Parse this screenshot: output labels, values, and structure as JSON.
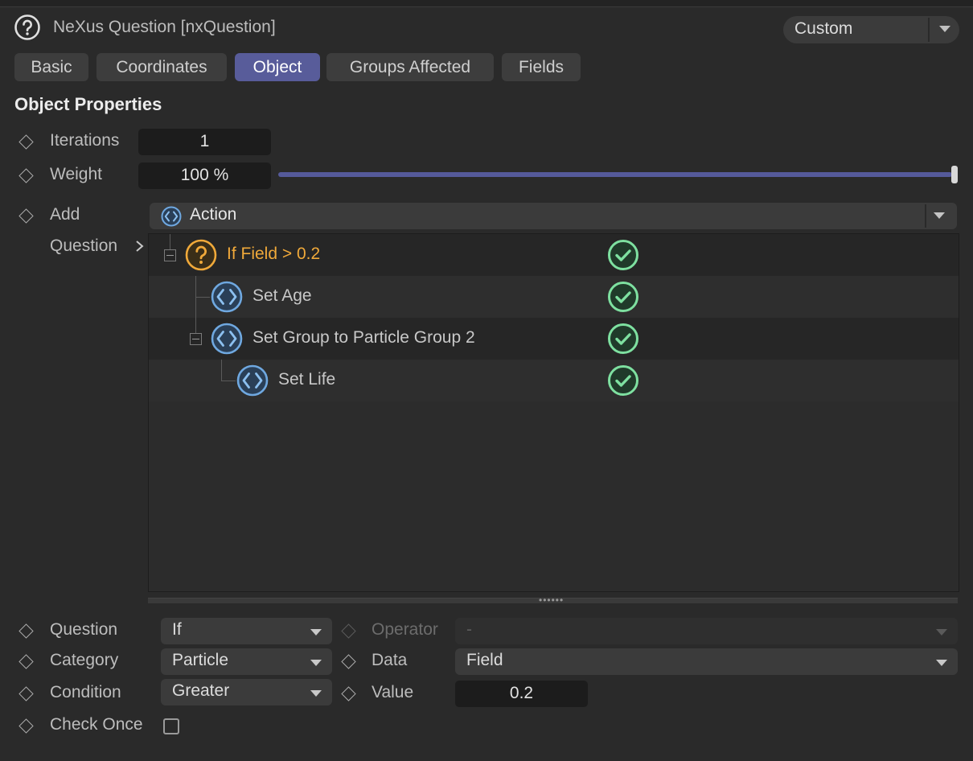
{
  "header": {
    "title": "NeXus Question [nxQuestion]",
    "preset": "Custom"
  },
  "tabs": [
    {
      "label": "Basic",
      "active": false
    },
    {
      "label": "Coordinates",
      "active": false
    },
    {
      "label": "Object",
      "active": true
    },
    {
      "label": "Groups Affected",
      "active": false
    },
    {
      "label": "Fields",
      "active": false
    }
  ],
  "section": {
    "title": "Object Properties"
  },
  "params": {
    "iterations": {
      "label": "Iterations",
      "value": "1"
    },
    "weight": {
      "label": "Weight",
      "value": "100 %",
      "slider_fraction": 1.0
    },
    "add": {
      "label": "Add",
      "value": "Action"
    },
    "question_tree_label": "Question"
  },
  "tree": [
    {
      "label": "If Field > 0.2",
      "type": "question",
      "depth": 0,
      "enabled": true,
      "highlight": true
    },
    {
      "label": "Set Age",
      "type": "action",
      "depth": 1,
      "enabled": true,
      "highlight": false
    },
    {
      "label": "Set Group to Particle Group 2",
      "type": "action",
      "depth": 1,
      "enabled": true,
      "highlight": false
    },
    {
      "label": "Set Life",
      "type": "action",
      "depth": 2,
      "enabled": true,
      "highlight": false
    }
  ],
  "bottom": {
    "question": {
      "label": "Question",
      "value": "If"
    },
    "operator": {
      "label": "Operator",
      "value": "-"
    },
    "category": {
      "label": "Category",
      "value": "Particle"
    },
    "data": {
      "label": "Data",
      "value": "Field"
    },
    "condition": {
      "label": "Condition",
      "value": "Greater"
    },
    "value": {
      "label": "Value",
      "value": "0.2"
    },
    "check_once": {
      "label": "Check Once",
      "checked": false
    }
  },
  "colors": {
    "accent": "#585c9a",
    "question_icon": "#f0a93a",
    "action_icon": "#6fa8e0",
    "check": "#7ee0a0"
  },
  "icons": {
    "header": "question-circle-icon",
    "action": "action-diamond-icon",
    "question": "question-circle-icon",
    "enabled": "check-circle-icon",
    "keyframe": "keyframe-diamond-icon"
  }
}
